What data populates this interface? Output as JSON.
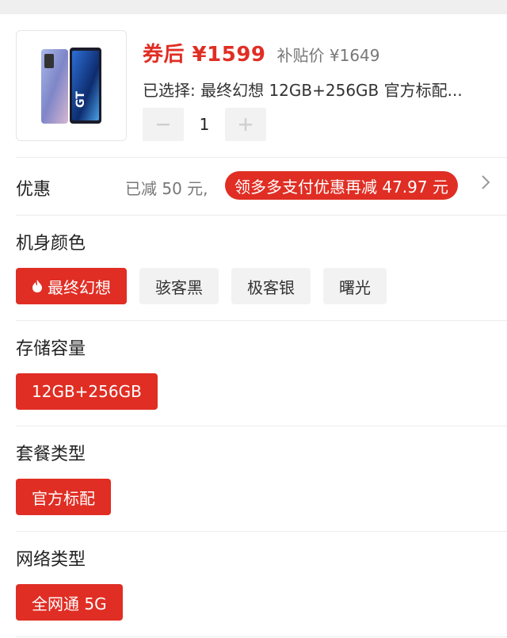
{
  "product": {
    "price_label": "券后 ¥1599",
    "subsidy_label": "补贴价 ¥1649",
    "selected_text": "已选择: 最终幻想 12GB+256GB 官方标配...",
    "quantity": "1",
    "decrement_icon": "minus-icon",
    "increment_icon": "plus-icon"
  },
  "promo": {
    "label": "优惠",
    "reduced": "已减 50 元,",
    "badge": "领多多支付优惠再减 47.97 元",
    "chevron_icon": "chevron-right-icon"
  },
  "options": {
    "color": {
      "title": "机身颜色",
      "items": [
        "最终幻想",
        "骇客黑",
        "极客银",
        "曙光"
      ]
    },
    "storage": {
      "title": "存储容量",
      "items": [
        "12GB+256GB"
      ]
    },
    "package": {
      "title": "套餐类型",
      "items": [
        "官方标配"
      ]
    },
    "network": {
      "title": "网络类型",
      "items": [
        "全网通 5G"
      ]
    }
  },
  "colors": {
    "accent": "#e02e24",
    "chip_bg": "#f2f2f2"
  }
}
